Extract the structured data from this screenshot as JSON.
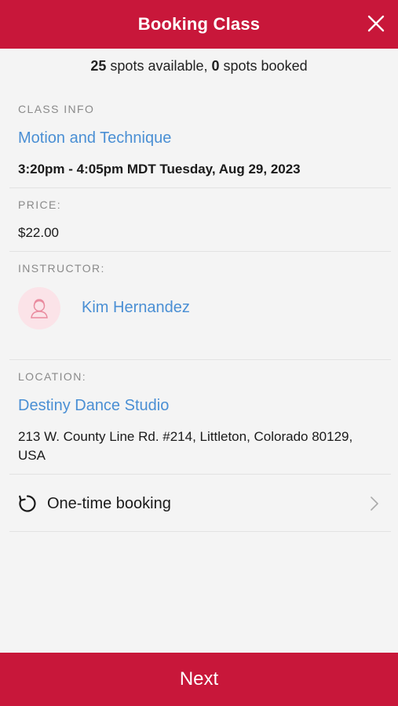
{
  "header": {
    "title": "Booking Class"
  },
  "spots": {
    "available_count": "25",
    "available_text": " spots available, ",
    "booked_count": "0",
    "booked_text": " spots booked"
  },
  "class_info": {
    "label": "CLASS INFO",
    "name": "Motion and Technique",
    "schedule": "3:20pm - 4:05pm MDT Tuesday, Aug 29, 2023"
  },
  "price": {
    "label": "PRICE:",
    "value": "$22.00"
  },
  "instructor": {
    "label": "INSTRUCTOR:",
    "name": "Kim Hernandez"
  },
  "location": {
    "label": "LOCATION:",
    "name": "Destiny Dance Studio",
    "address_line1": "213 W. County Line Rd. #214, Littleton, Colorado 80129,",
    "address_line2": "USA"
  },
  "booking": {
    "type_label": "One-time booking"
  },
  "footer": {
    "next_label": "Next"
  },
  "colors": {
    "brand": "#c8173a",
    "link": "#4a8fd4",
    "label_gray": "#8a8a8a",
    "avatar_bg": "#fbe3e8"
  },
  "icons": {
    "close": "close-icon",
    "repeat": "refresh-icon",
    "chevron": "chevron-right-icon",
    "avatar": "user-avatar-icon"
  }
}
